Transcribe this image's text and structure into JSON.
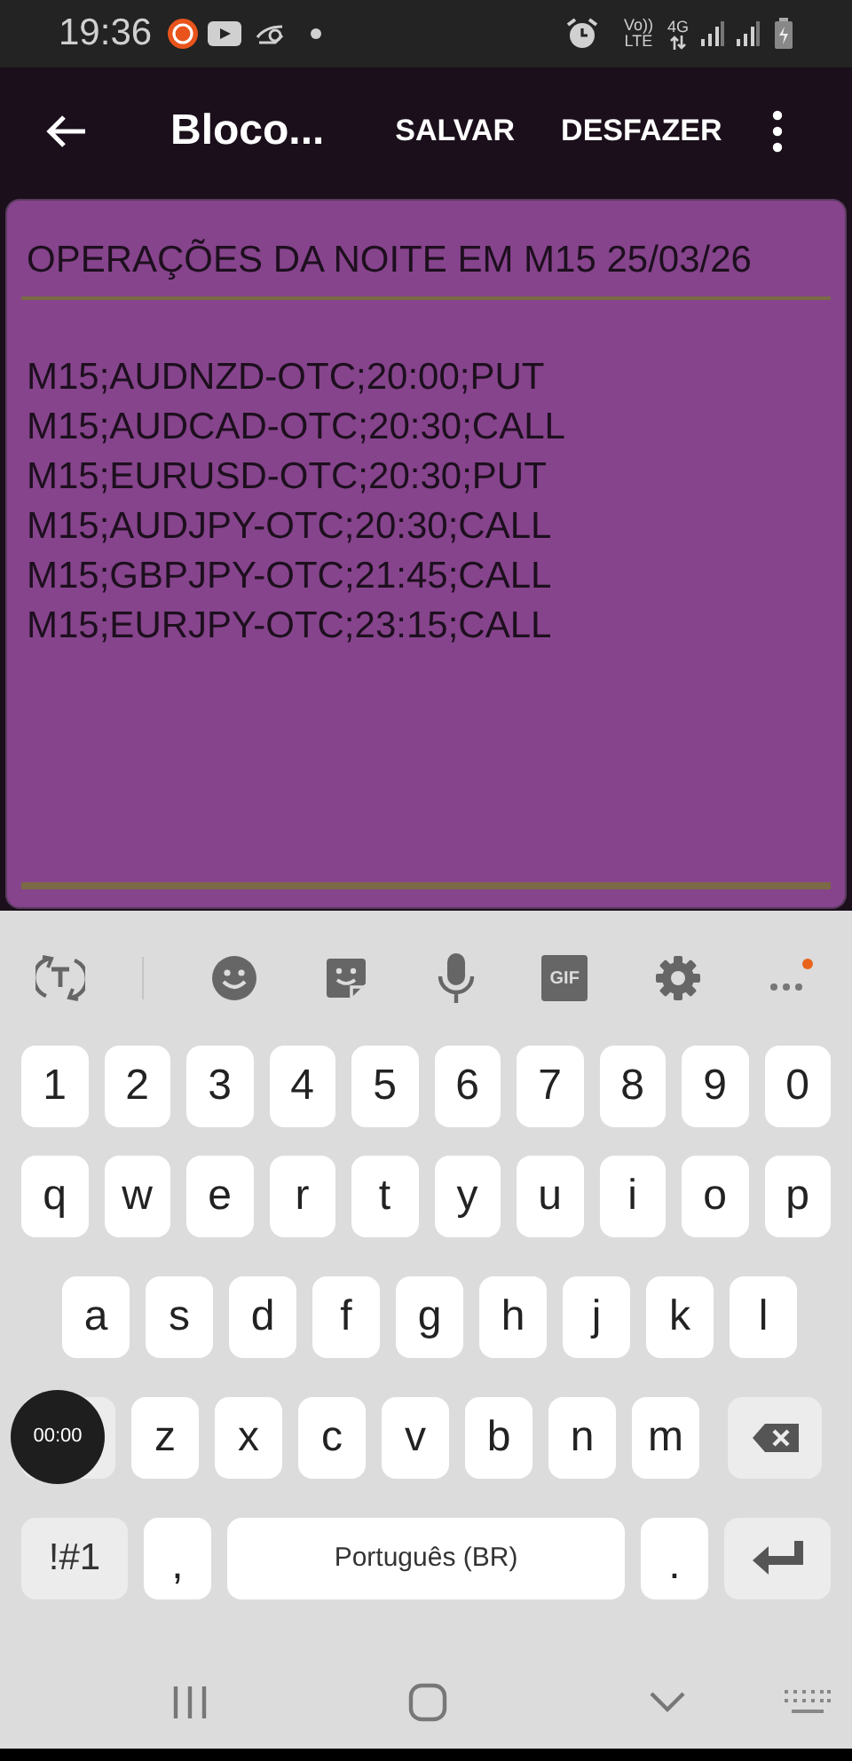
{
  "status_bar": {
    "time": "19:36",
    "volte": "Vo))",
    "lte": "LTE",
    "network": "4G"
  },
  "app_bar": {
    "title": "Bloco...",
    "actions": [
      "SALVAR",
      "DESFAZER"
    ]
  },
  "note": {
    "title": "OPERAÇÕES DA NOITE EM M15 25/03/26",
    "lines": [
      "M15;AUDNZD-OTC;20:00;PUT",
      "M15;AUDCAD-OTC;20:30;CALL",
      "M15;EURUSD-OTC;20:30;PUT",
      "M15;AUDJPY-OTC;20:30;CALL",
      "M15;GBPJPY-OTC;21:45;CALL",
      "M15;EURJPY-OTC;23:15;CALL"
    ]
  },
  "keyboard": {
    "gif_label": "GIF",
    "number_row": [
      "1",
      "2",
      "3",
      "4",
      "5",
      "6",
      "7",
      "8",
      "9",
      "0"
    ],
    "letter_rows": [
      [
        "q",
        "w",
        "e",
        "r",
        "t",
        "y",
        "u",
        "i",
        "o",
        "p"
      ],
      [
        "a",
        "s",
        "d",
        "f",
        "g",
        "h",
        "j",
        "k",
        "l"
      ],
      [
        "z",
        "x",
        "c",
        "v",
        "b",
        "n",
        "m"
      ]
    ],
    "symbols_key": "!#1",
    "comma_key": ",",
    "space_key": "Português (BR)",
    "period_key": "."
  },
  "recording_overlay": {
    "timer": "00:00"
  }
}
